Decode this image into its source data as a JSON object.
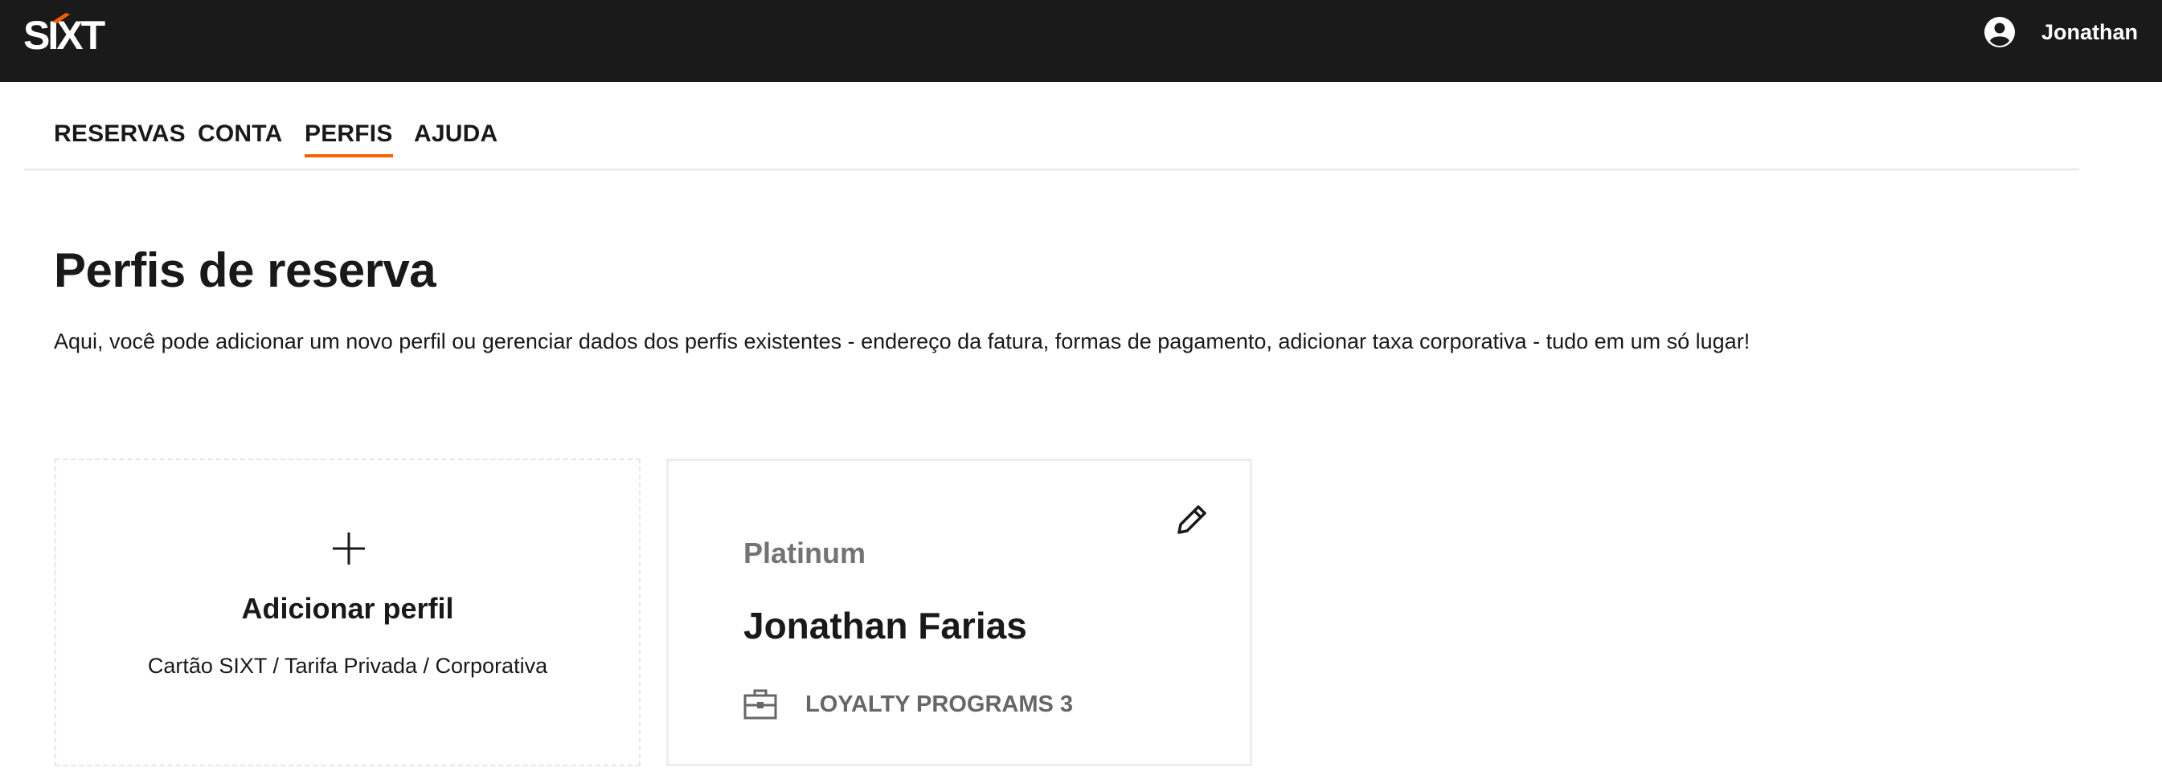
{
  "header": {
    "logo_text": "SIXT",
    "user_icon": "account-circle-icon",
    "user_name": "Jonathan",
    "background_color": "#1a1a1a",
    "accent_color": "#ff5f00"
  },
  "nav": {
    "tabs": [
      {
        "label": "RESERVAS",
        "active": false
      },
      {
        "label": "CONTA",
        "active": false
      },
      {
        "label": "PERFIS",
        "active": true
      },
      {
        "label": "AJUDA",
        "active": false
      }
    ]
  },
  "main": {
    "title": "Perfis de reserva",
    "description": "Aqui, você pode adicionar um novo perfil ou gerenciar dados dos perfis existentes - endereço da fatura, formas de pagamento, adicionar taxa corporativa - tudo em um só lugar!",
    "add_card": {
      "icon": "plus-icon",
      "title": "Adicionar perfil",
      "subtitle": "Cartão SIXT / Tarifa Privada / Corporativa"
    },
    "profile_card": {
      "tier": "Platinum",
      "name": "Jonathan Farias",
      "edit_icon": "pencil-icon",
      "detail_icon": "briefcase-icon",
      "detail_label": "LOYALTY PROGRAMS 3"
    }
  }
}
